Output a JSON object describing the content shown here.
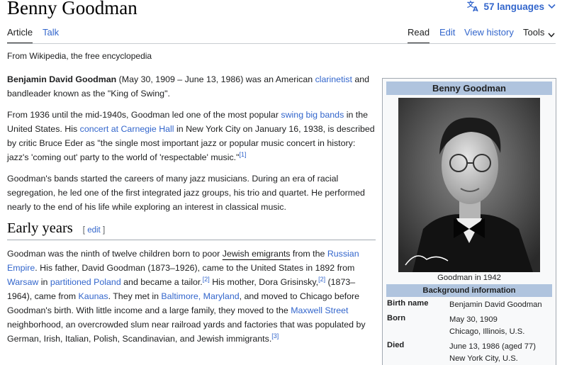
{
  "page": {
    "title": "Benny Goodman",
    "languages_label": "57 languages"
  },
  "tabs": {
    "article": "Article",
    "talk": "Talk",
    "read": "Read",
    "edit": "Edit",
    "view_history": "View history",
    "tools": "Tools"
  },
  "tagline": "From Wikipedia, the free encyclopedia",
  "intro": {
    "p1_bold": "Benjamin David Goodman",
    "p1_a": " (May 30, 1909 – June 13, 1986) was an American ",
    "p1_link": "clarinetist",
    "p1_b": " and bandleader known as the \"King of Swing\".",
    "p2_a": "From 1936 until the mid-1940s, Goodman led one of the most popular ",
    "p2_link1": "swing big bands",
    "p2_b": " in the United States. His ",
    "p2_link2": "concert at Carnegie Hall",
    "p2_c": " in New York City on January 16, 1938, is described by critic Bruce Eder as \"the single most important jazz or popular music concert in history: jazz's 'coming out' party to the world of 'respectable' music.\"",
    "p2_ref": "[1]",
    "p3": "Goodman's bands started the careers of many jazz musicians. During an era of racial segregation, he led one of the first integrated jazz groups, his trio and quartet. He performed nearly to the end of his life while exploring an interest in classical music."
  },
  "section": {
    "heading": "Early years",
    "edit_open": "[",
    "edit_label": "edit",
    "edit_close": "]",
    "t1": "Goodman was the ninth of twelve children born to poor ",
    "l1": "Jewish emigrants",
    "t2": " from the ",
    "l2": "Russian Empire",
    "t3": ". His father, David Goodman (1873–1926), came to the United States in 1892 from ",
    "l3": "Warsaw",
    "t4": " in ",
    "l4": "partitioned Poland",
    "t5": " and became a tailor.",
    "r1": "[2]",
    "t6": " His mother, Dora Grisinsky,",
    "r2": "[2]",
    "t7": " (1873–1964), came from ",
    "l5": "Kaunas",
    "t8": ". They met in ",
    "l6": "Baltimore, Maryland",
    "t9": ", and moved to Chicago before Goodman's birth. With little income and a large family, they moved to the ",
    "l7": "Maxwell Street",
    "t10": " neighborhood, an overcrowded slum near railroad yards and factories that was populated by German, Irish, Italian, Polish, Scandinavian, and Jewish immigrants.",
    "r3": "[3]"
  },
  "infobox": {
    "header": "Benny Goodman",
    "caption": "Goodman in 1942",
    "subheader": "Background information",
    "rows": [
      {
        "label": "Birth name",
        "value1": "Benjamin David Goodman",
        "value2": ""
      },
      {
        "label": "Born",
        "value1": "May 30, 1909",
        "value2": "Chicago, Illinois, U.S."
      },
      {
        "label": "Died",
        "value1": "June 13, 1986 (aged 77)",
        "value2": "New York City, U.S."
      }
    ]
  }
}
